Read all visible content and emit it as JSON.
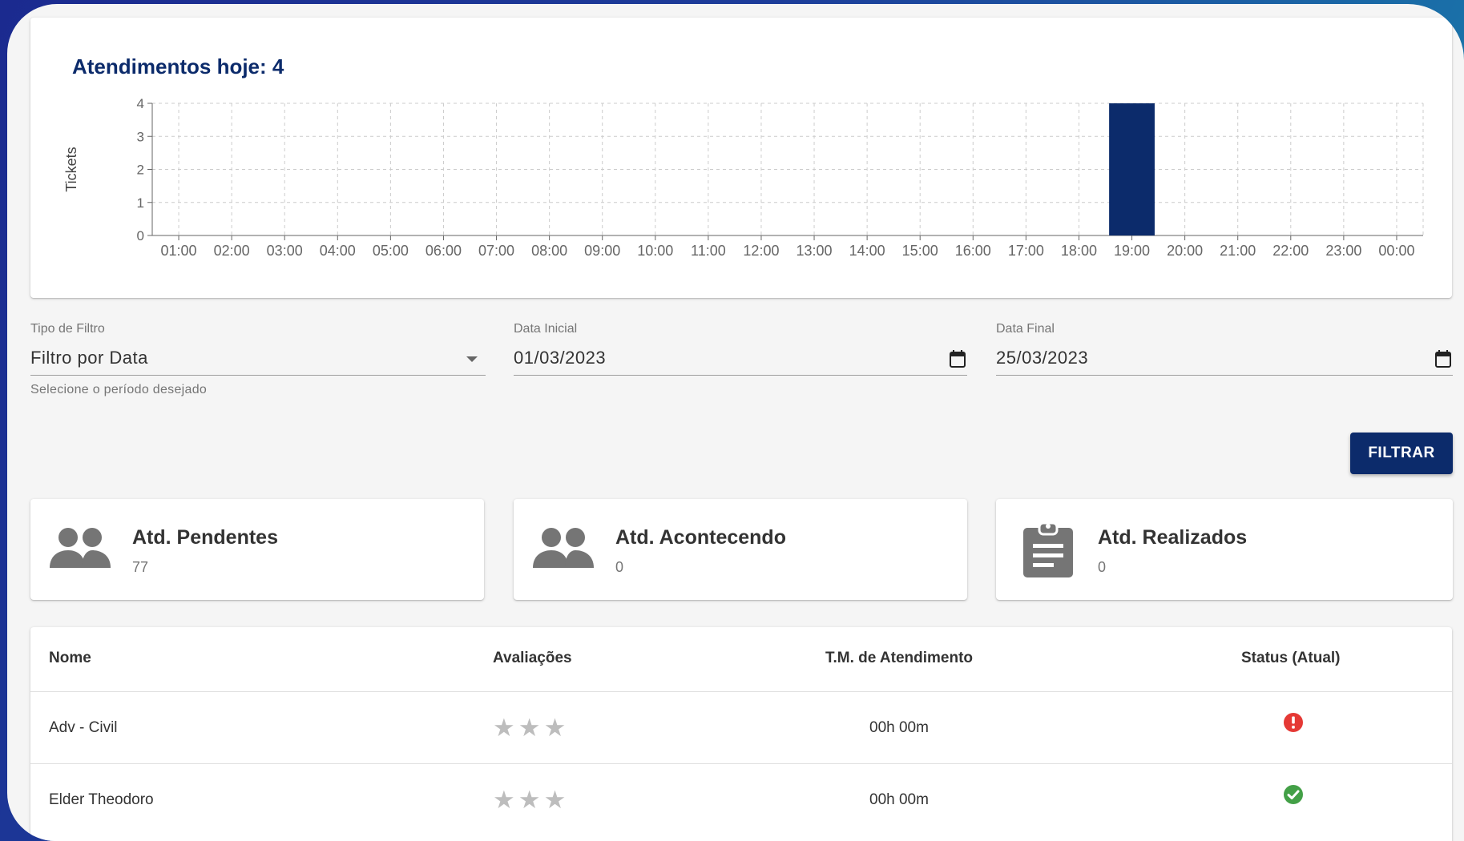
{
  "chart_card": {
    "title": "Atendimentos hoje: 4"
  },
  "chart_data": {
    "type": "bar",
    "ylabel": "Tickets",
    "xlabel": "",
    "ylim": [
      0,
      4
    ],
    "yticks": [
      "0",
      "1",
      "2",
      "3",
      "4"
    ],
    "categories": [
      "01:00",
      "02:00",
      "03:00",
      "04:00",
      "05:00",
      "06:00",
      "07:00",
      "08:00",
      "09:00",
      "10:00",
      "11:00",
      "12:00",
      "13:00",
      "14:00",
      "15:00",
      "16:00",
      "17:00",
      "18:00",
      "19:00",
      "20:00",
      "21:00",
      "22:00",
      "23:00",
      "00:00"
    ],
    "values": [
      0,
      0,
      0,
      0,
      0,
      0,
      0,
      0,
      0,
      0,
      0,
      0,
      0,
      0,
      0,
      0,
      0,
      0,
      4,
      0,
      0,
      0,
      0,
      0
    ],
    "grid": true,
    "bar_color": "#0c2b6b"
  },
  "filters": {
    "tipo": {
      "label": "Tipo de Filtro",
      "value": "Filtro por Data",
      "helper": "Selecione o período desejado"
    },
    "data_inicial": {
      "label": "Data Inicial",
      "value": "01/03/2023"
    },
    "data_final": {
      "label": "Data Final",
      "value": "25/03/2023"
    },
    "button_label": "FILTRAR"
  },
  "stats": {
    "pendentes": {
      "title": "Atd. Pendentes",
      "count": "77",
      "icon": "people-icon"
    },
    "acontecendo": {
      "title": "Atd. Acontecendo",
      "count": "0",
      "icon": "people-icon"
    },
    "realizados": {
      "title": "Atd. Realizados",
      "count": "0",
      "icon": "clipboard-icon"
    }
  },
  "table": {
    "headers": {
      "nome": "Nome",
      "avaliacoes": "Avaliações",
      "tm": "T.M. de Atendimento",
      "status": "Status (Atual)"
    },
    "rows": [
      {
        "nome": "Adv - Civil",
        "stars": 3,
        "tm": "00h 00m",
        "status": "offline",
        "status_color": "#e53935"
      },
      {
        "nome": "Elder Theodoro",
        "stars": 3,
        "tm": "00h 00m",
        "status": "online",
        "status_color": "#43a047"
      }
    ]
  },
  "colors": {
    "primary": "#0c2b6b",
    "background": "#f5f5f5"
  }
}
